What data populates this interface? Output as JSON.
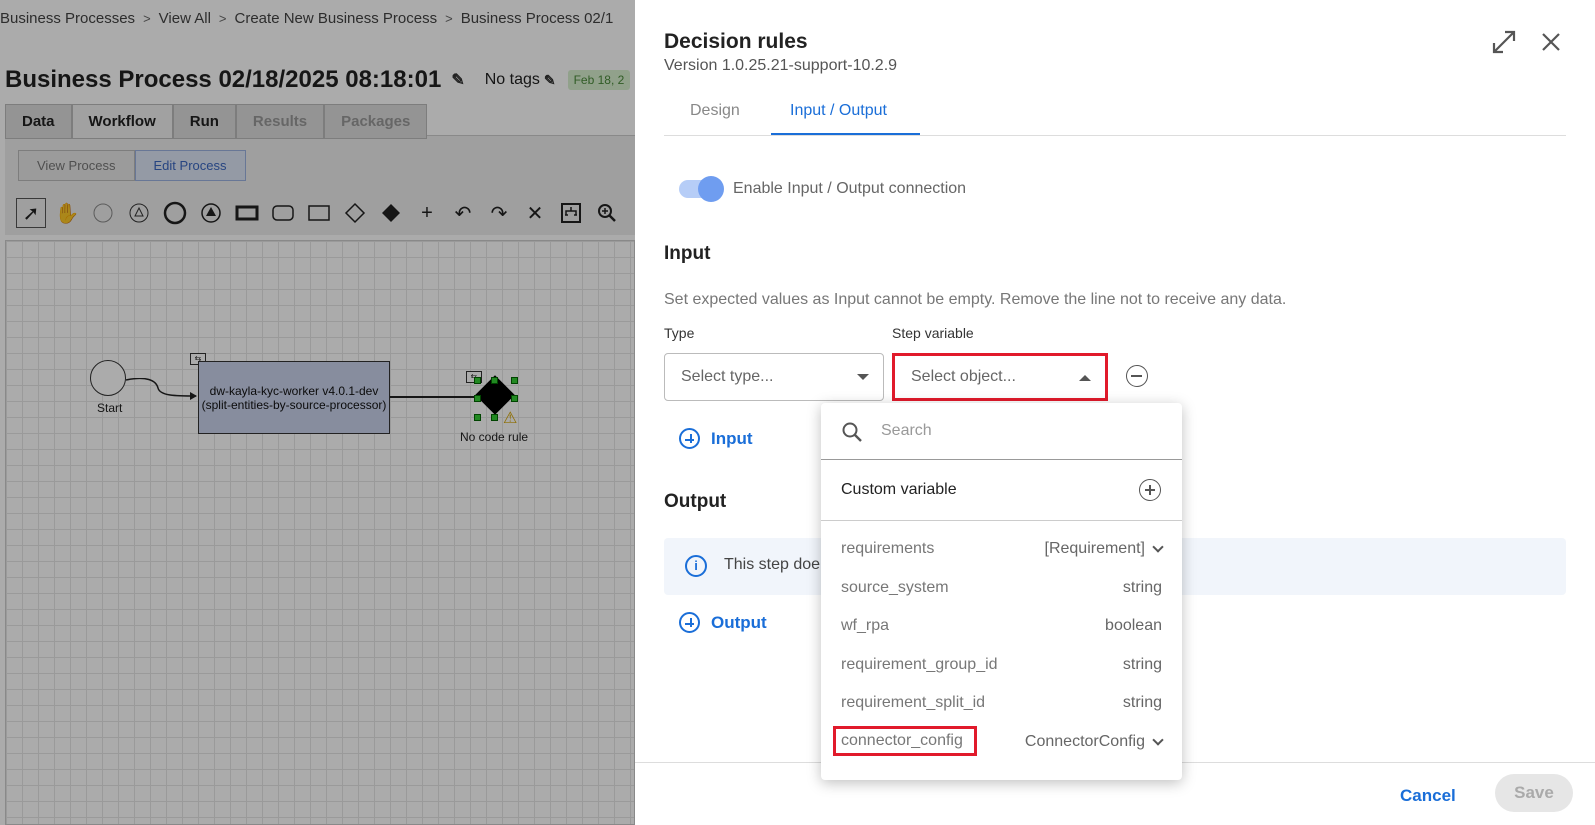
{
  "background": {
    "breadcrumbs": [
      "Business Processes",
      "View All",
      "Create New Business Process",
      "Business Process 02/1"
    ],
    "title": "Business Process 02/18/2025 08:18:01",
    "tags_label": "No tags",
    "date_badge": "Feb 18, 2",
    "tabs": [
      "Data",
      "Workflow",
      "Run",
      "Results",
      "Packages"
    ],
    "modes": [
      "View Process",
      "Edit Process"
    ],
    "tools": [
      "pointer-icon",
      "hand-icon",
      "circle-thin-icon",
      "triangle-circle-icon",
      "circle-icon",
      "triangle-circle-filled-icon",
      "rect-thick-icon",
      "rounded-rect-icon",
      "rect-icon",
      "diamond-icon",
      "diamond-filled-icon",
      "plus-icon",
      "undo-icon",
      "redo-icon",
      "x-icon",
      "layout-icon",
      "zoom-icon"
    ],
    "diagram": {
      "start_label": "Start",
      "task_label_1": "dw-kayla-kyc-worker v4.0.1-dev",
      "task_label_2": "(split-entities-by-source-processor)",
      "gateway_label": "No code rule"
    }
  },
  "panel": {
    "title": "Decision rules",
    "version": "Version 1.0.25.21-support-10.2.9",
    "tabs": [
      {
        "label": "Design",
        "active": false
      },
      {
        "label": "Input / Output",
        "active": true
      }
    ],
    "toggle_label": "Enable Input / Output connection",
    "toggle_on": true,
    "input": {
      "title": "Input",
      "description": "Set expected values as Input cannot be empty. Remove the line not to receive any data.",
      "type_label": "Type",
      "type_placeholder": "Select type...",
      "step_var_label": "Step variable",
      "step_var_placeholder": "Select object...",
      "add_label": "Input"
    },
    "output": {
      "title": "Output",
      "info_text": "This step doe",
      "add_label": "Output"
    },
    "footer": {
      "cancel": "Cancel",
      "save": "Save"
    },
    "accent_color": "#1a6ed8",
    "highlight_color": "#e11a2b"
  },
  "dropdown": {
    "search_placeholder": "Search",
    "custom_variable_label": "Custom variable",
    "items": [
      {
        "name": "requirements",
        "type": "[Requirement]",
        "expandable": true
      },
      {
        "name": "source_system",
        "type": "string",
        "expandable": false
      },
      {
        "name": "wf_rpa",
        "type": "boolean",
        "expandable": false
      },
      {
        "name": "requirement_group_id",
        "type": "string",
        "expandable": false
      },
      {
        "name": "requirement_split_id",
        "type": "string",
        "expandable": false
      },
      {
        "name": "connector_config",
        "type": "ConnectorConfig",
        "expandable": true,
        "highlighted": true
      }
    ]
  }
}
